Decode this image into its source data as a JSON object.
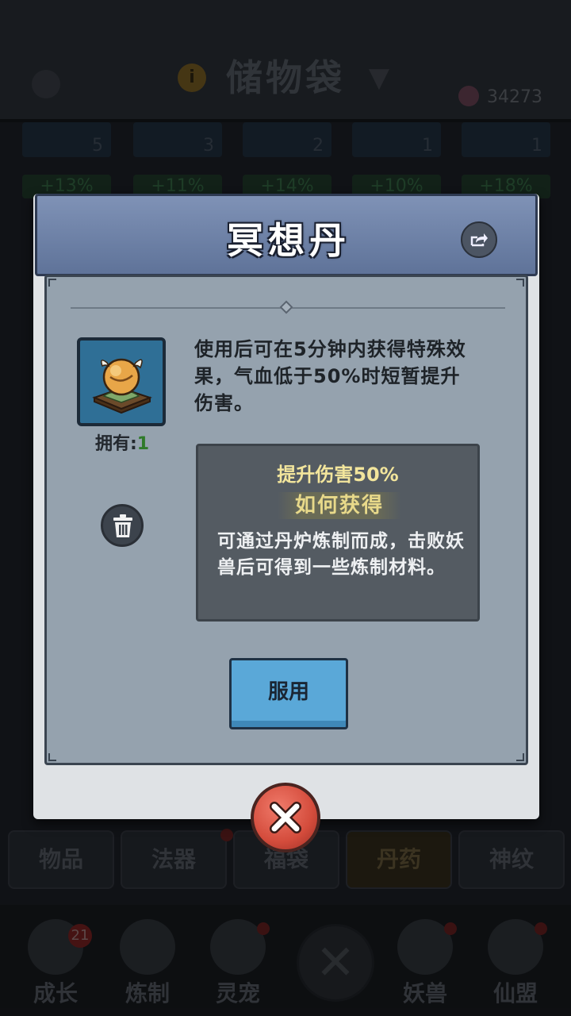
{
  "background": {
    "title": "储物袋",
    "currency": "34273",
    "counts": [
      "5",
      "3",
      "2",
      "1",
      "1"
    ],
    "bonuses": [
      "+13%",
      "+11%",
      "+14%",
      "+10%",
      "+18%"
    ],
    "tabs": [
      {
        "label": "物品"
      },
      {
        "label": "法器"
      },
      {
        "label": "福袋"
      },
      {
        "label": "丹药"
      },
      {
        "label": "神纹"
      }
    ],
    "nav": [
      {
        "label": "成长",
        "badge": "21"
      },
      {
        "label": "炼制"
      },
      {
        "label": "灵宠"
      },
      {
        "label": ""
      },
      {
        "label": "妖兽"
      },
      {
        "label": "仙盟"
      }
    ]
  },
  "dialog": {
    "title": "冥想丹",
    "owned_label": "拥有:",
    "owned_count": "1",
    "description": "使用后可在5分钟内获得特殊效果，气血低于50%时短暂提升伤害。",
    "effect": "提升伤害50%",
    "howto_title": "如何获得",
    "howto_desc": "可通过丹炉炼制而成，击败妖兽后可得到一些炼制材料。",
    "use_label": "服用"
  },
  "colors": {
    "header": "#6f83a8",
    "body": "#95a2ae",
    "use_button": "#5aa8d8",
    "close_button": "#d44c3c",
    "effect_text": "#f2e59c"
  }
}
